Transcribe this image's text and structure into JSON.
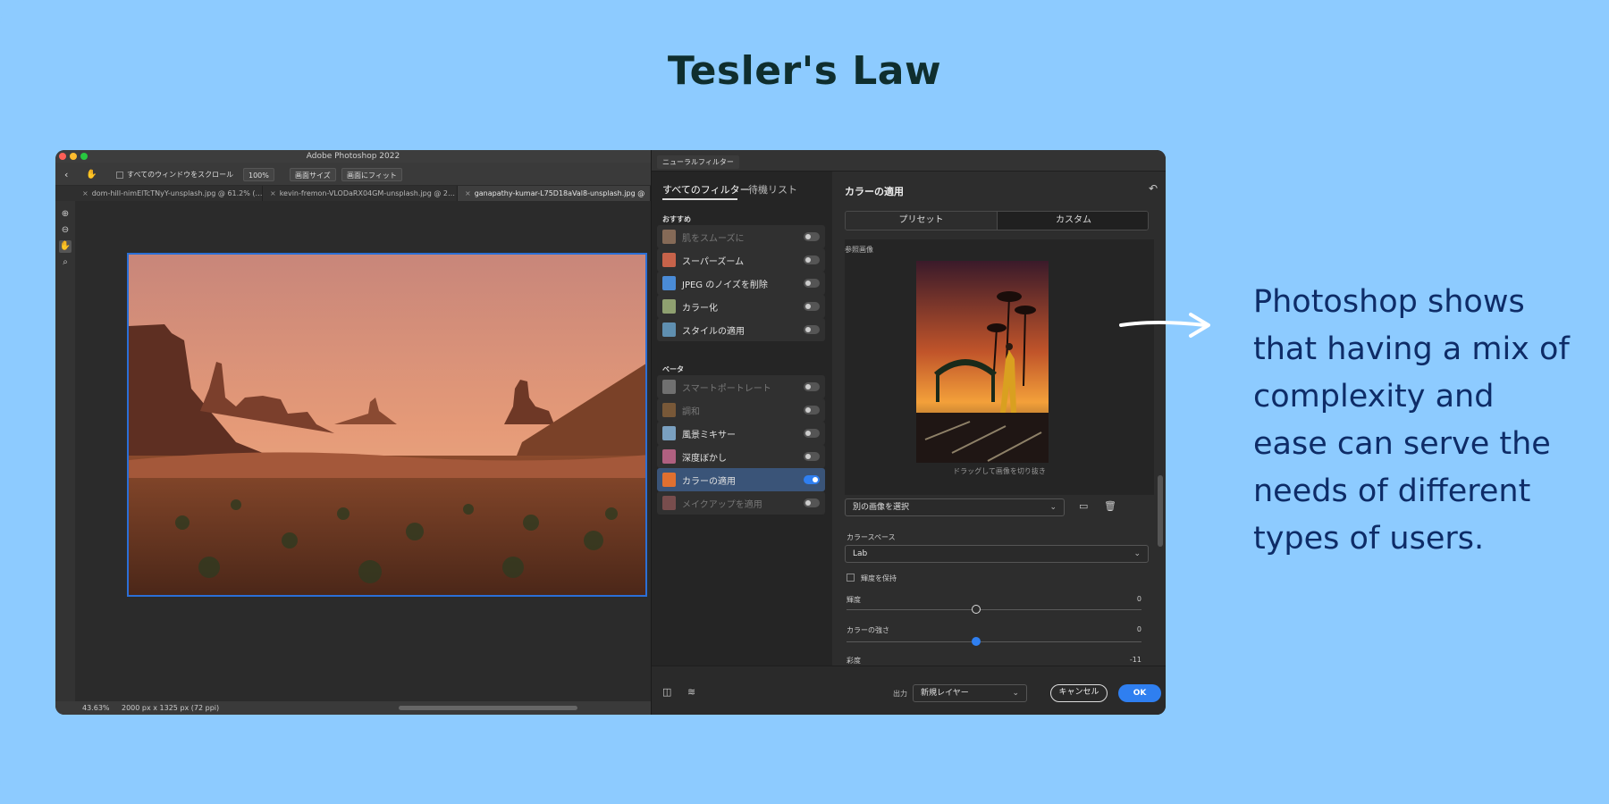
{
  "page": {
    "title": "Tesler's Law"
  },
  "caption": {
    "text": "Photoshop shows that having a mix of complexity and ease can serve the needs of different types of users."
  },
  "colors": {
    "background": "#8dcbff",
    "caption": "#0e2c67",
    "title": "#0f2e2e",
    "accent": "#2f7ff0"
  },
  "photoshop": {
    "window_title": "Adobe Photoshop 2022",
    "options": {
      "back_icon": "chevron-left-icon",
      "hand_icon": "hand-icon",
      "scroll_all_label": "すべてのウィンドウをスクロール",
      "zoom_100": "100%",
      "fit_screen": "画面サイズ",
      "fill_screen": "画面にフィット"
    },
    "tabs": [
      {
        "label": "dom-hill-nimElTcTNyY-unsplash.jpg @ 61.2% (…"
      },
      {
        "label": "kevin-fremon-VLODaRX04GM-unsplash.jpg @ 2…"
      },
      {
        "label": "ganapathy-kumar-L75D18aVal8-unsplash.jpg @"
      }
    ],
    "tools": [
      "zoom-in-icon",
      "zoom-out-icon",
      "hand-icon",
      "magnifier-icon"
    ],
    "status": {
      "zoom": "43.63%",
      "doc_info": "2000 px x 1325 px (72 ppi)"
    }
  },
  "neural_filters": {
    "panel_label": "ニューラルフィルター",
    "tabs": {
      "all": "すべてのフィルター",
      "waitlist": "待機リスト"
    },
    "featured_label": "おすすめ",
    "featured": [
      {
        "label": "肌をスムーズに",
        "enabled": false,
        "disabled": true
      },
      {
        "label": "スーパーズーム",
        "enabled": false,
        "disabled": false
      },
      {
        "label": "JPEG のノイズを削除",
        "enabled": false,
        "disabled": false
      },
      {
        "label": "カラー化",
        "enabled": false,
        "disabled": false
      },
      {
        "label": "スタイルの適用",
        "enabled": false,
        "disabled": false
      }
    ],
    "beta_label": "ベータ",
    "beta": [
      {
        "label": "スマートポートレート",
        "enabled": false,
        "disabled": true
      },
      {
        "label": "調和",
        "enabled": false,
        "disabled": true
      },
      {
        "label": "風景ミキサー",
        "enabled": false,
        "disabled": false
      },
      {
        "label": "深度ぼかし",
        "enabled": false,
        "disabled": false
      },
      {
        "label": "カラーの適用",
        "enabled": true,
        "disabled": false
      },
      {
        "label": "メイクアップを適用",
        "enabled": false,
        "disabled": true
      }
    ],
    "detail": {
      "title": "カラーの適用",
      "reset_icon": "reset-icon",
      "preset_label": "プリセット",
      "custom_label": "カスタム",
      "reference_label": "参照画像",
      "drag_hint": "ドラッグして画像を切り抜き",
      "choose_image": "別の画像を選択",
      "folder_icon": "folder-icon",
      "trash_icon": "trash-icon",
      "color_space_label": "カラースペース",
      "color_space_value": "Lab",
      "preserve_luminance": "輝度を保持",
      "sliders": [
        {
          "label": "輝度",
          "value": "0",
          "fraction": 0.44,
          "active": false
        },
        {
          "label": "カラーの強さ",
          "value": "0",
          "fraction": 0.44,
          "active": true
        },
        {
          "label": "彩度",
          "value": "-11"
        }
      ]
    },
    "footer": {
      "output_label": "出力",
      "output_value": "新規レイヤー",
      "cancel": "キャンセル",
      "ok": "OK",
      "compare_icon": "split-view-icon",
      "layers_icon": "layers-icon"
    }
  }
}
